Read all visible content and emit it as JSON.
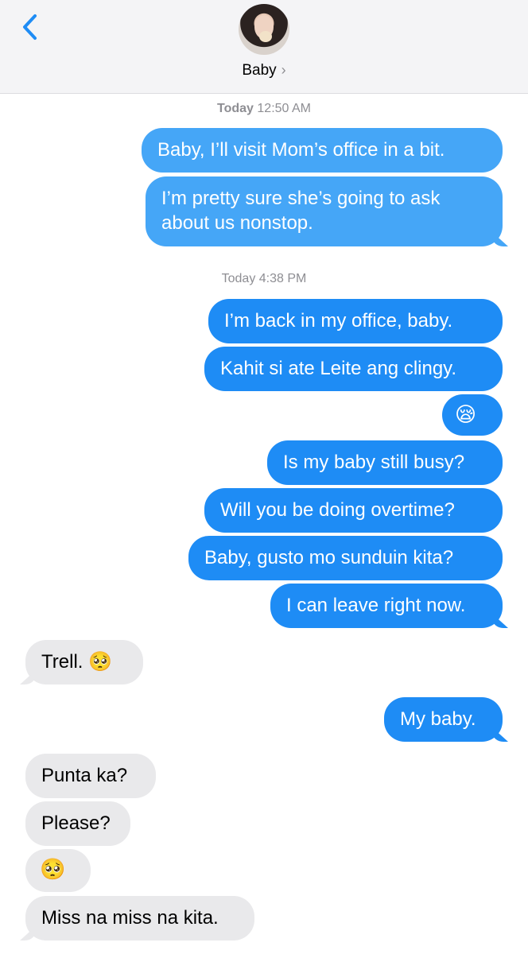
{
  "header": {
    "contact_name": "Baby",
    "contact_chevron": "›",
    "back_icon": "chevron-left-icon",
    "accent_color": "#1e8cf5"
  },
  "timestamps": [
    {
      "day": "Today",
      "time": "12:50 AM"
    },
    {
      "day": "Today",
      "time": "4:38 PM"
    }
  ],
  "messages": [
    {
      "dir": "out",
      "text": "Baby, I’ll visit Mom’s office in a bit."
    },
    {
      "dir": "out",
      "text": "I’m pretty sure she’s going to ask about us nonstop."
    },
    {
      "dir": "out",
      "text": "I’m back in my office, baby."
    },
    {
      "dir": "out",
      "text": "Kahit si ate Leite ang clingy."
    },
    {
      "dir": "out",
      "text": "😪"
    },
    {
      "dir": "out",
      "text": "Is my baby still busy?"
    },
    {
      "dir": "out",
      "text": "Will you be doing overtime?"
    },
    {
      "dir": "out",
      "text": "Baby, gusto mo sunduin kita?"
    },
    {
      "dir": "out",
      "text": "I can leave right now."
    },
    {
      "dir": "in",
      "text": "Trell. 🥺"
    },
    {
      "dir": "out",
      "text": "My baby."
    },
    {
      "dir": "in",
      "text": "Punta ka?"
    },
    {
      "dir": "in",
      "text": "Please?"
    },
    {
      "dir": "in",
      "text": "🥺"
    },
    {
      "dir": "in",
      "text": "Miss na miss na kita."
    }
  ]
}
